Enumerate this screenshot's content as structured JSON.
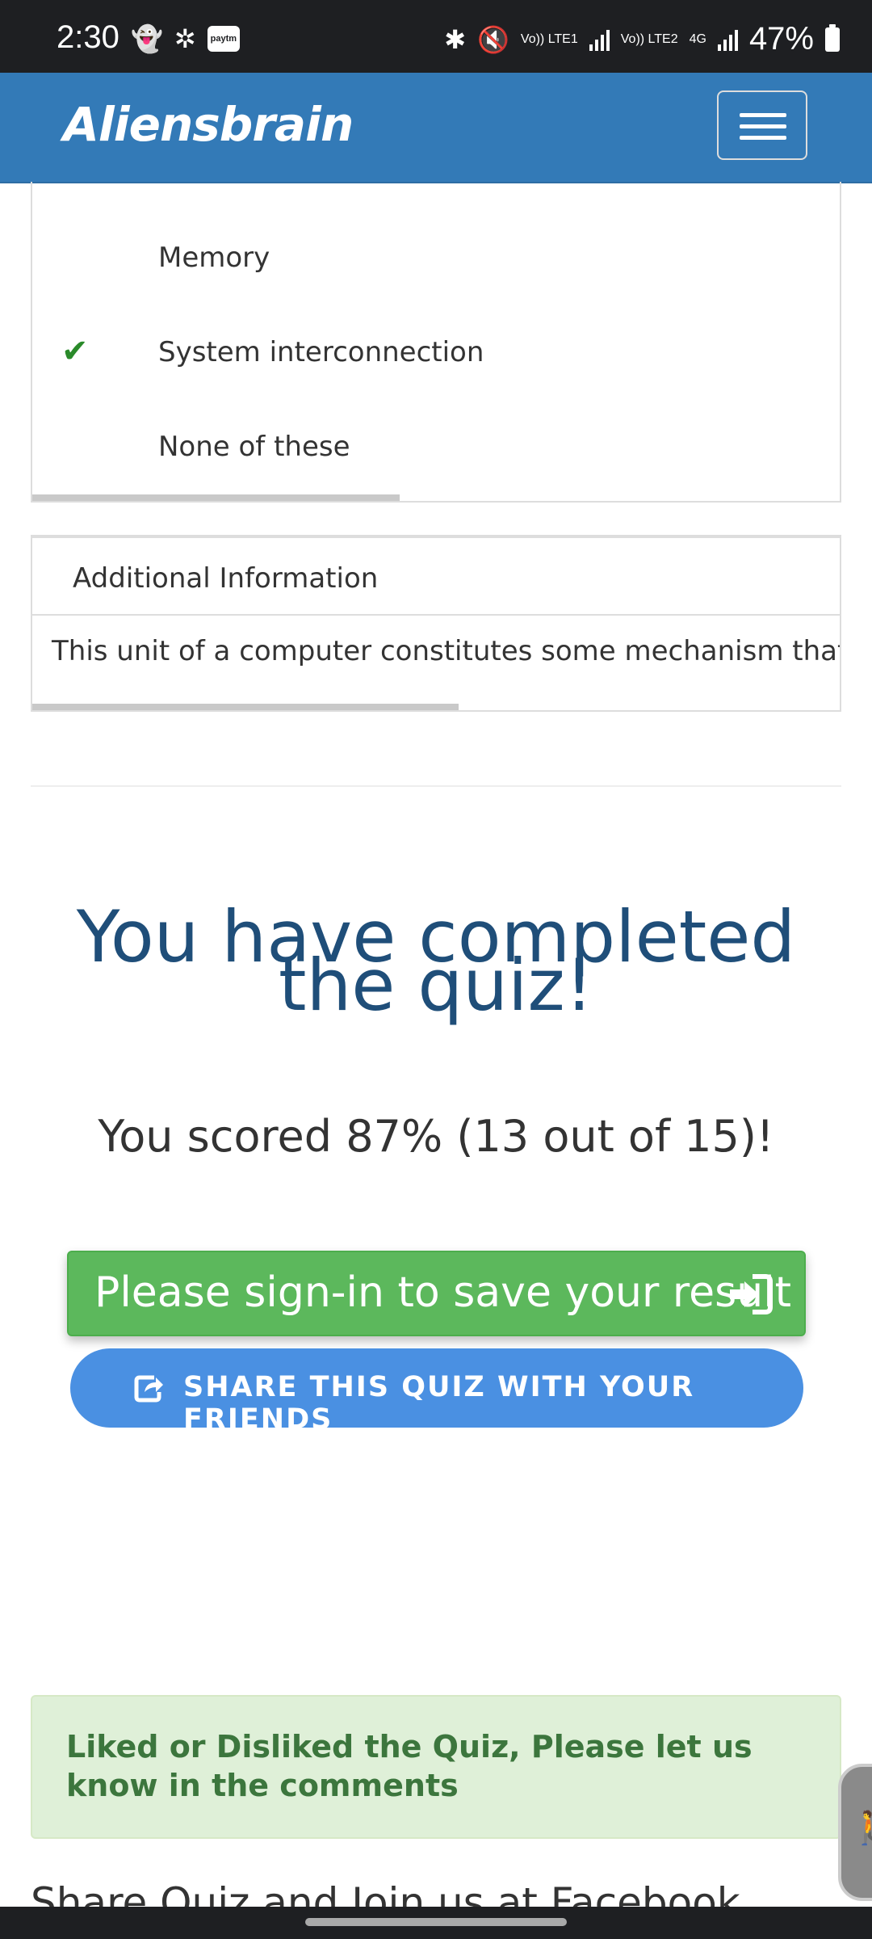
{
  "status_bar": {
    "time": "2:30",
    "paytm_label": "paytm",
    "volte1": "Vo)) LTE1",
    "volte2": "Vo)) LTE2",
    "net_type": "4G",
    "battery": "47%"
  },
  "navbar": {
    "brand": "Aliensbrain"
  },
  "question_options": {
    "items": [
      {
        "label": "Memory",
        "correct": false
      },
      {
        "label": "System interconnection",
        "correct": true
      },
      {
        "label": "None of these",
        "correct": false
      }
    ]
  },
  "additional_info": {
    "heading": "Additional Information",
    "body": "This unit of a computer constitutes some mechanism that pro"
  },
  "result": {
    "title": "You have completed the quiz!",
    "score_text": "You scored 87% (13 out of 15)!",
    "score_percent": 87,
    "correct": 13,
    "total": 15
  },
  "buttons": {
    "signin_label": "Please sign-in to save your result",
    "share_label": "SHARE THIS QUIZ WITH YOUR FRIENDS"
  },
  "feedback": {
    "text": "Liked or Disliked the Quiz, Please let us know in the comments"
  },
  "footer_heading": "Share Quiz and Join us at Facebook",
  "colors": {
    "navbar": "#337ab7",
    "title": "#1f4e79",
    "signin_button": "#5cb85c",
    "share_button": "#4a90e2",
    "feedback_bg": "#dff0d8",
    "feedback_text": "#3c763d",
    "check": "#2a8a2a"
  },
  "icons": {
    "check": "check-icon",
    "signin": "sign-in-icon",
    "share": "share-icon",
    "accessibility": "accessibility-icon",
    "menu": "hamburger-menu-icon"
  }
}
